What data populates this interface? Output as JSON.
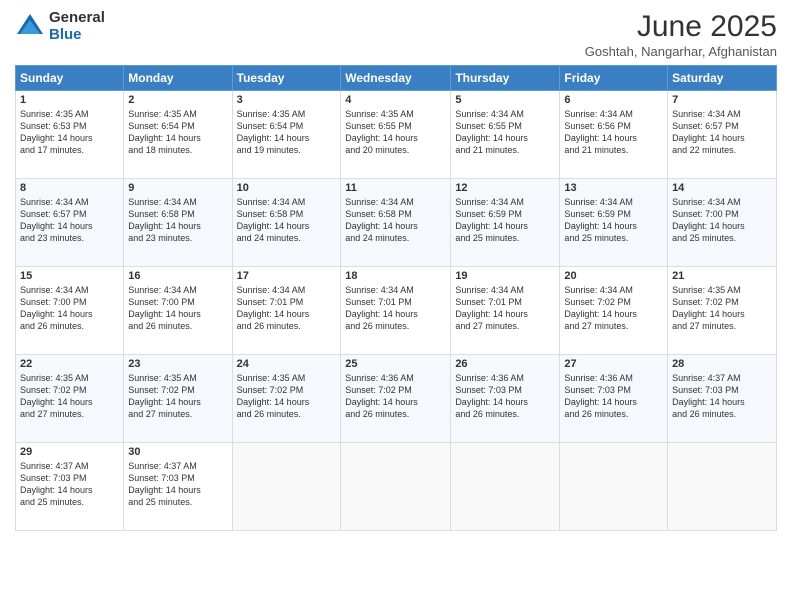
{
  "logo": {
    "general": "General",
    "blue": "Blue"
  },
  "header": {
    "month": "June 2025",
    "location": "Goshtah, Nangarhar, Afghanistan"
  },
  "days": [
    "Sunday",
    "Monday",
    "Tuesday",
    "Wednesday",
    "Thursday",
    "Friday",
    "Saturday"
  ],
  "weeks": [
    [
      {
        "day": "1",
        "sunrise": "4:35 AM",
        "sunset": "6:53 PM",
        "daylight": "14 hours and 17 minutes."
      },
      {
        "day": "2",
        "sunrise": "4:35 AM",
        "sunset": "6:54 PM",
        "daylight": "14 hours and 18 minutes."
      },
      {
        "day": "3",
        "sunrise": "4:35 AM",
        "sunset": "6:54 PM",
        "daylight": "14 hours and 19 minutes."
      },
      {
        "day": "4",
        "sunrise": "4:35 AM",
        "sunset": "6:55 PM",
        "daylight": "14 hours and 20 minutes."
      },
      {
        "day": "5",
        "sunrise": "4:34 AM",
        "sunset": "6:55 PM",
        "daylight": "14 hours and 21 minutes."
      },
      {
        "day": "6",
        "sunrise": "4:34 AM",
        "sunset": "6:56 PM",
        "daylight": "14 hours and 21 minutes."
      },
      {
        "day": "7",
        "sunrise": "4:34 AM",
        "sunset": "6:57 PM",
        "daylight": "14 hours and 22 minutes."
      }
    ],
    [
      {
        "day": "8",
        "sunrise": "4:34 AM",
        "sunset": "6:57 PM",
        "daylight": "14 hours and 23 minutes."
      },
      {
        "day": "9",
        "sunrise": "4:34 AM",
        "sunset": "6:58 PM",
        "daylight": "14 hours and 23 minutes."
      },
      {
        "day": "10",
        "sunrise": "4:34 AM",
        "sunset": "6:58 PM",
        "daylight": "14 hours and 24 minutes."
      },
      {
        "day": "11",
        "sunrise": "4:34 AM",
        "sunset": "6:58 PM",
        "daylight": "14 hours and 24 minutes."
      },
      {
        "day": "12",
        "sunrise": "4:34 AM",
        "sunset": "6:59 PM",
        "daylight": "14 hours and 25 minutes."
      },
      {
        "day": "13",
        "sunrise": "4:34 AM",
        "sunset": "6:59 PM",
        "daylight": "14 hours and 25 minutes."
      },
      {
        "day": "14",
        "sunrise": "4:34 AM",
        "sunset": "7:00 PM",
        "daylight": "14 hours and 25 minutes."
      }
    ],
    [
      {
        "day": "15",
        "sunrise": "4:34 AM",
        "sunset": "7:00 PM",
        "daylight": "14 hours and 26 minutes."
      },
      {
        "day": "16",
        "sunrise": "4:34 AM",
        "sunset": "7:00 PM",
        "daylight": "14 hours and 26 minutes."
      },
      {
        "day": "17",
        "sunrise": "4:34 AM",
        "sunset": "7:01 PM",
        "daylight": "14 hours and 26 minutes."
      },
      {
        "day": "18",
        "sunrise": "4:34 AM",
        "sunset": "7:01 PM",
        "daylight": "14 hours and 26 minutes."
      },
      {
        "day": "19",
        "sunrise": "4:34 AM",
        "sunset": "7:01 PM",
        "daylight": "14 hours and 27 minutes."
      },
      {
        "day": "20",
        "sunrise": "4:34 AM",
        "sunset": "7:02 PM",
        "daylight": "14 hours and 27 minutes."
      },
      {
        "day": "21",
        "sunrise": "4:35 AM",
        "sunset": "7:02 PM",
        "daylight": "14 hours and 27 minutes."
      }
    ],
    [
      {
        "day": "22",
        "sunrise": "4:35 AM",
        "sunset": "7:02 PM",
        "daylight": "14 hours and 27 minutes."
      },
      {
        "day": "23",
        "sunrise": "4:35 AM",
        "sunset": "7:02 PM",
        "daylight": "14 hours and 27 minutes."
      },
      {
        "day": "24",
        "sunrise": "4:35 AM",
        "sunset": "7:02 PM",
        "daylight": "14 hours and 26 minutes."
      },
      {
        "day": "25",
        "sunrise": "4:36 AM",
        "sunset": "7:02 PM",
        "daylight": "14 hours and 26 minutes."
      },
      {
        "day": "26",
        "sunrise": "4:36 AM",
        "sunset": "7:03 PM",
        "daylight": "14 hours and 26 minutes."
      },
      {
        "day": "27",
        "sunrise": "4:36 AM",
        "sunset": "7:03 PM",
        "daylight": "14 hours and 26 minutes."
      },
      {
        "day": "28",
        "sunrise": "4:37 AM",
        "sunset": "7:03 PM",
        "daylight": "14 hours and 26 minutes."
      }
    ],
    [
      {
        "day": "29",
        "sunrise": "4:37 AM",
        "sunset": "7:03 PM",
        "daylight": "14 hours and 25 minutes."
      },
      {
        "day": "30",
        "sunrise": "4:37 AM",
        "sunset": "7:03 PM",
        "daylight": "14 hours and 25 minutes."
      },
      null,
      null,
      null,
      null,
      null
    ]
  ]
}
